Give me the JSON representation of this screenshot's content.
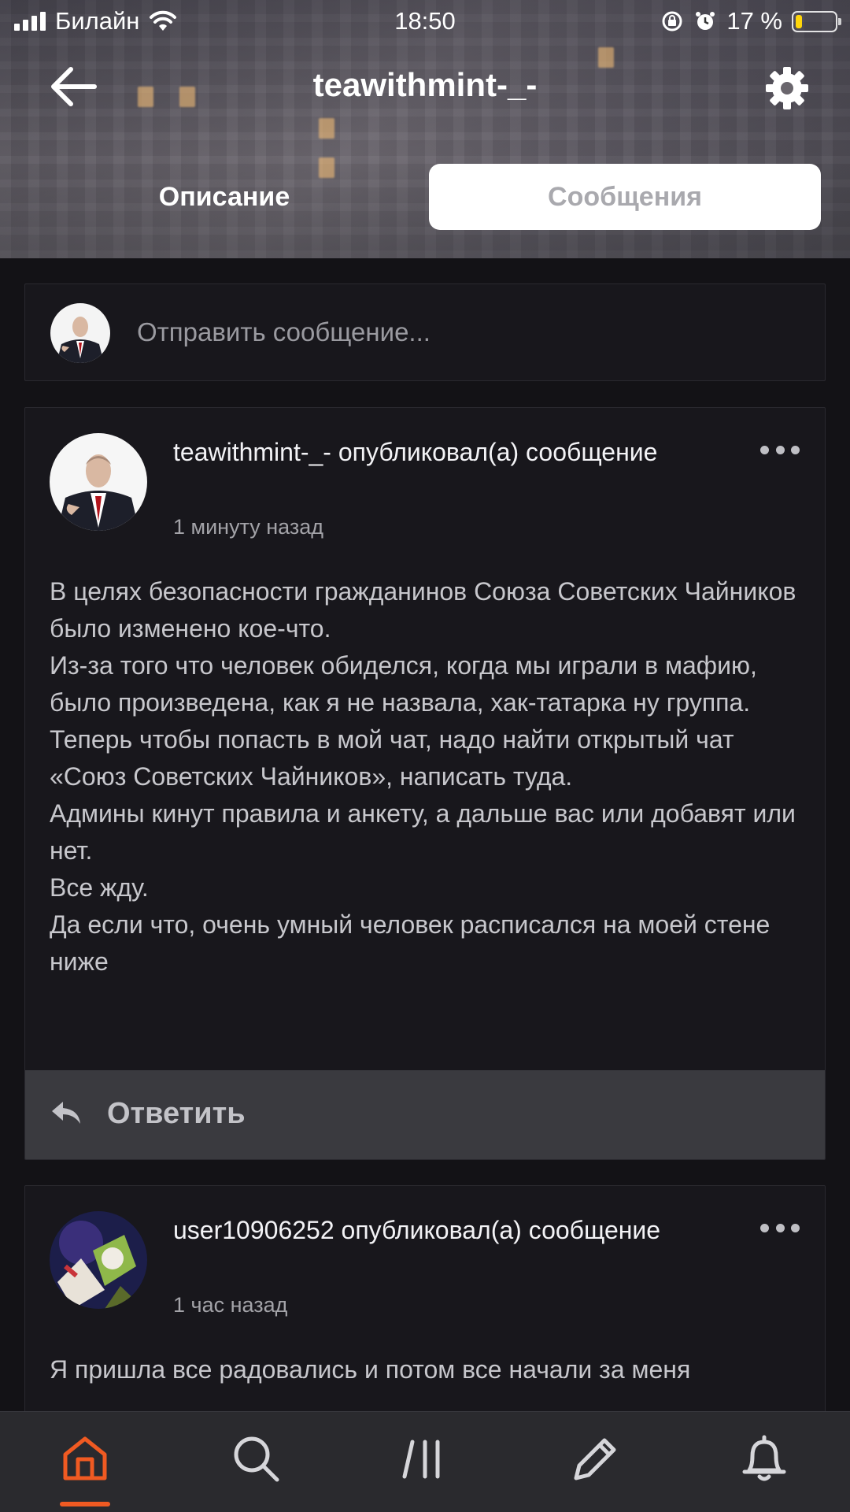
{
  "status_bar": {
    "carrier": "Билайн",
    "time": "18:50",
    "battery_percent": "17 %",
    "battery_level": 0.17
  },
  "header": {
    "title": "teawithmint-_-",
    "back_icon": "arrow-left-icon",
    "settings_icon": "gear-icon"
  },
  "tabs": [
    {
      "label": "Описание",
      "active": false
    },
    {
      "label": "Сообщения",
      "active": true
    }
  ],
  "composer": {
    "placeholder": "Отправить сообщение..."
  },
  "posts": [
    {
      "author": "teawithmint-_-",
      "action": "опубликовал(а) сообщение",
      "time": "1 минуту назад",
      "body": "В целях безопасности гражданинов Союза Советских Чайников было изменено кое-что.\nИз-за того что человек обиделся, когда мы играли в мафию, было произведена, как я не назвала, хак-татарка ну группа.\nТеперь чтобы попасть в мой чат, надо найти открытый чат «Союз Советских Чайников», написать туда.\nАдмины кинут правила и анкету, а дальше вас или добавят или нет.\nВсе жду.\nДа если что, очень умный человек расписался на моей стене ниже",
      "reply_label": "Ответить"
    },
    {
      "author": "user10906252",
      "action": "опубликовал(а) сообщение",
      "time": "1 час назад",
      "body": "Я пришла все радовались и потом все начали за меня"
    }
  ],
  "bottom_nav": [
    {
      "icon": "home-icon",
      "active": true
    },
    {
      "icon": "search-icon",
      "active": false
    },
    {
      "icon": "feed-icon",
      "active": false
    },
    {
      "icon": "pencil-icon",
      "active": false
    },
    {
      "icon": "bell-icon",
      "active": false
    }
  ],
  "colors": {
    "background": "#131216",
    "card": "#18171c",
    "accent": "#f05a22",
    "reply_bar": "#3a3a3f"
  }
}
